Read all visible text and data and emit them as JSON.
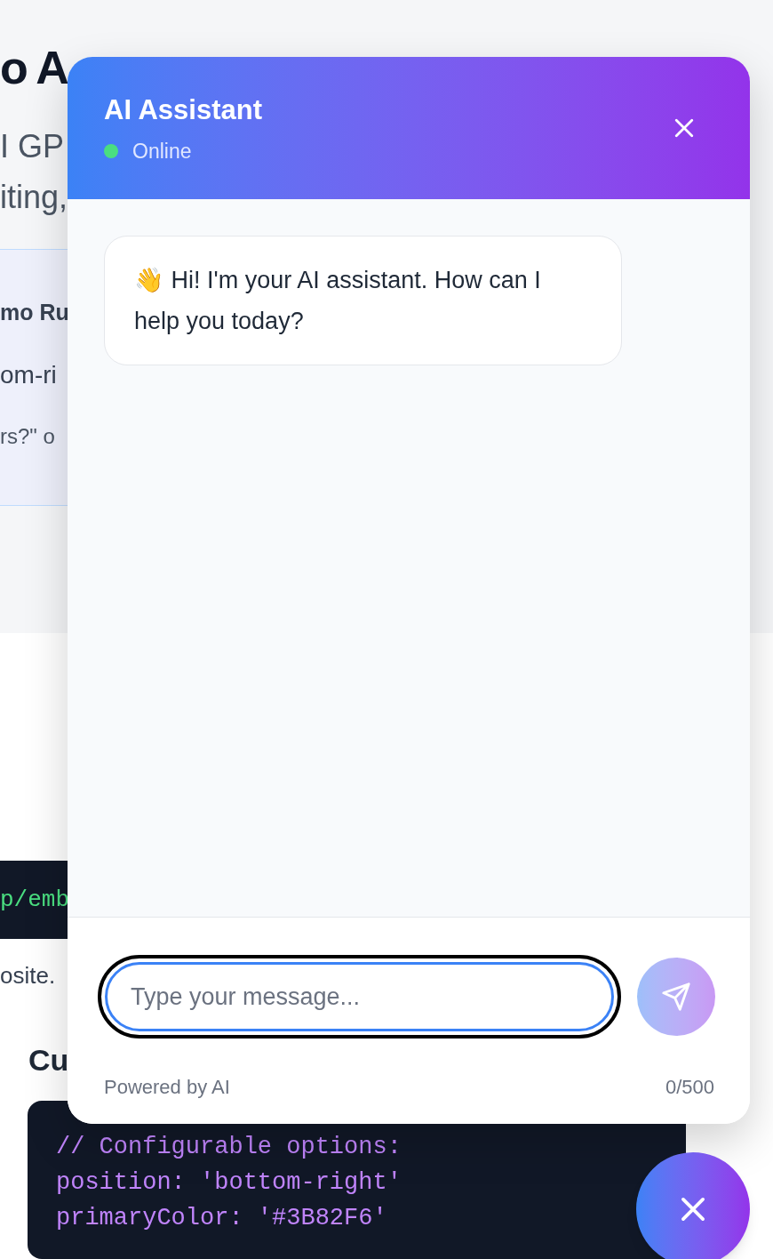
{
  "background_page": {
    "heading": "o A",
    "subtitle_lines": [
      "I GP",
      "iting,"
    ],
    "demo_box": {
      "title": "mo Ru",
      "line_1": "om-ri",
      "line_2": "rs?\" o"
    },
    "embed_code": "p/emb",
    "embed_note": "osite.",
    "section_heading": "Cu",
    "config_code": [
      "// Configurable options:",
      "position: 'bottom-right'",
      "primaryColor: '#3B82F6'"
    ]
  },
  "chat_widget": {
    "title": "AI Assistant",
    "status": {
      "label": "Online",
      "online": true
    },
    "messages": [
      {
        "text": "👋 Hi! I'm your AI assistant. How can I help you today?"
      }
    ],
    "input": {
      "placeholder": "Type your message...",
      "focused": true
    },
    "send_button": {
      "disabled": true
    },
    "footer": {
      "note": "Powered by AI",
      "counter": "0/500"
    }
  },
  "launcher": {
    "open": true
  }
}
